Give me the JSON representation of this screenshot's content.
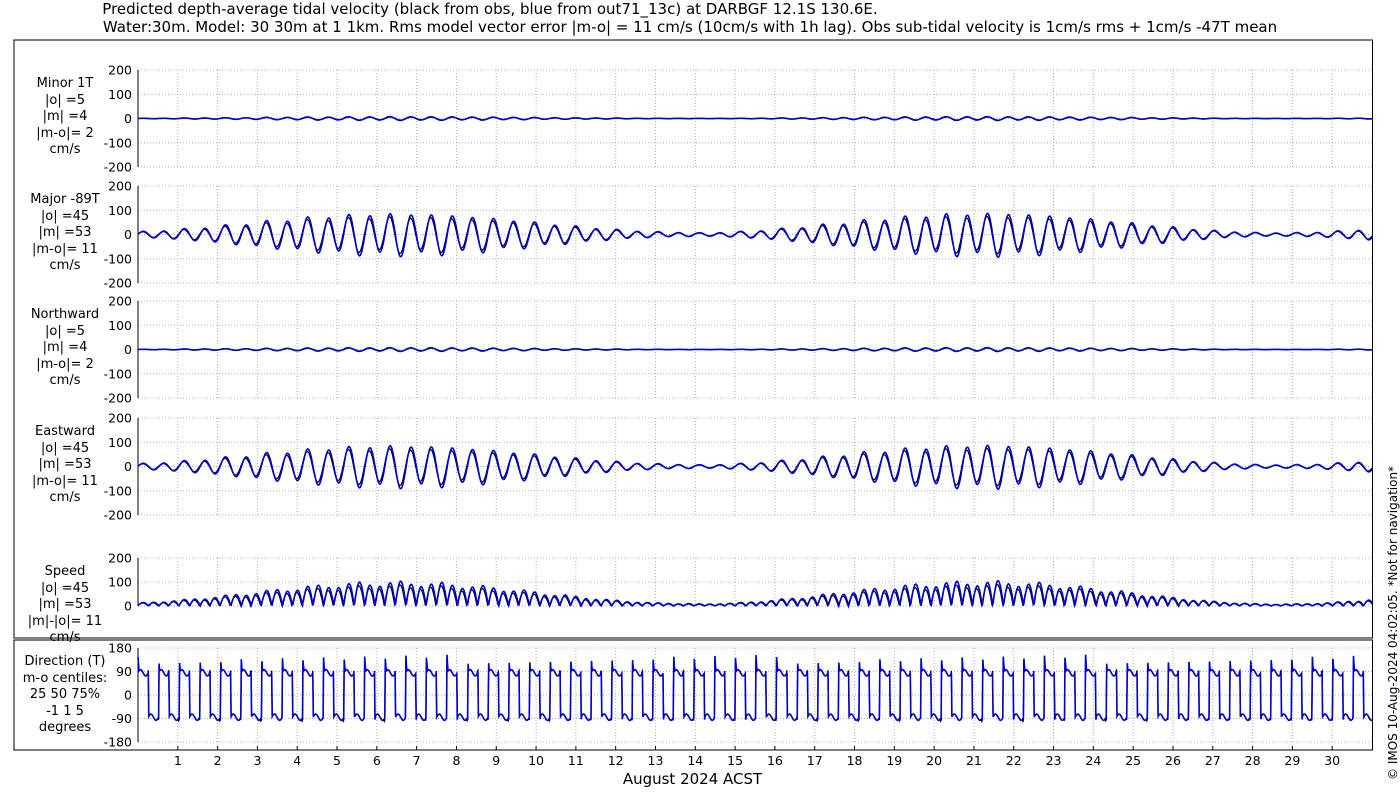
{
  "title": {
    "line1": "Predicted depth-average tidal velocity (black from obs, blue from out71_13c) at DARBGF 12.1S 130.6E.",
    "line2": "Water:30m. Model: 30 30m at 1 1km. Rms model vector error |m-o| = 11 cm/s (10cm/s with 1h lag). Obs sub-tidal velocity is 1cm/s rms + 1cm/s -47T mean"
  },
  "side_note": "© IMOS 10-Aug-2024 04:02:05. *Not for navigation*",
  "x_axis_label": "August 2024 ACST",
  "colors": {
    "obs": "#000000",
    "model": "#0000cc",
    "grid": "#b0b0b0"
  },
  "chart_data": [
    {
      "type": "line",
      "name": "minor",
      "label_lines": [
        "Minor 1T",
        "|o| =5",
        "|m| =4",
        "|m-o|= 2",
        "cm/s"
      ],
      "ylim": [
        -200,
        200
      ],
      "yticks": [
        "200",
        "100",
        "0",
        "-100",
        "-200"
      ],
      "amplitude_cm_s": {
        "obs": 5,
        "model": 4
      },
      "series": [
        {
          "name": "obs"
        },
        {
          "name": "model"
        }
      ]
    },
    {
      "type": "line",
      "name": "major",
      "label_lines": [
        "Major -89T",
        "|o| =45",
        "|m| =53",
        "|m-o|= 11",
        "cm/s"
      ],
      "ylim": [
        -200,
        200
      ],
      "yticks": [
        "200",
        "100",
        "0",
        "-100",
        "-200"
      ],
      "amplitude_cm_s": {
        "obs": 45,
        "model": 53
      },
      "series": [
        {
          "name": "obs"
        },
        {
          "name": "model"
        }
      ]
    },
    {
      "type": "line",
      "name": "northward",
      "label_lines": [
        "Northward",
        "|o| =5",
        "|m| =4",
        "|m-o|= 2",
        "cm/s"
      ],
      "ylim": [
        -200,
        200
      ],
      "yticks": [
        "200",
        "100",
        "0",
        "-100",
        "-200"
      ],
      "amplitude_cm_s": {
        "obs": 5,
        "model": 4
      },
      "series": [
        {
          "name": "obs"
        },
        {
          "name": "model"
        }
      ]
    },
    {
      "type": "line",
      "name": "eastward",
      "label_lines": [
        "Eastward",
        "|o| =45",
        "|m| =53",
        "|m-o|= 11",
        "cm/s"
      ],
      "ylim": [
        -200,
        200
      ],
      "yticks": [
        "200",
        "100",
        "0",
        "-100",
        "-200"
      ],
      "amplitude_cm_s": {
        "obs": 45,
        "model": 53
      },
      "series": [
        {
          "name": "obs"
        },
        {
          "name": "model"
        }
      ]
    },
    {
      "type": "line",
      "name": "speed",
      "label_lines": [
        "Speed",
        "|o| =45",
        "|m| =53",
        "|m|-|o|= 11",
        "cm/s"
      ],
      "ylim": [
        0,
        200
      ],
      "yticks": [
        "200",
        "100",
        "0"
      ],
      "amplitude_cm_s": {
        "obs": 45,
        "model": 53
      },
      "series": [
        {
          "name": "obs"
        },
        {
          "name": "model"
        }
      ]
    },
    {
      "type": "line",
      "name": "direction",
      "label_lines": [
        "Direction (T)",
        "m-o centiles:",
        "25  50  75%",
        "-1  1  5",
        "degrees"
      ],
      "ylim": [
        -180,
        180
      ],
      "yticks": [
        "180",
        "90",
        "0",
        "-90",
        "-180"
      ],
      "series": [
        {
          "name": "obs"
        },
        {
          "name": "model"
        }
      ]
    }
  ],
  "x_axis": {
    "range_days": [
      0,
      31
    ],
    "tick_labels": [
      "1",
      "2",
      "3",
      "4",
      "5",
      "6",
      "7",
      "8",
      "9",
      "10",
      "11",
      "12",
      "13",
      "14",
      "15",
      "16",
      "17",
      "18",
      "19",
      "20",
      "21",
      "22",
      "23",
      "24",
      "25",
      "26",
      "27",
      "28",
      "29",
      "30"
    ],
    "grid": true
  }
}
